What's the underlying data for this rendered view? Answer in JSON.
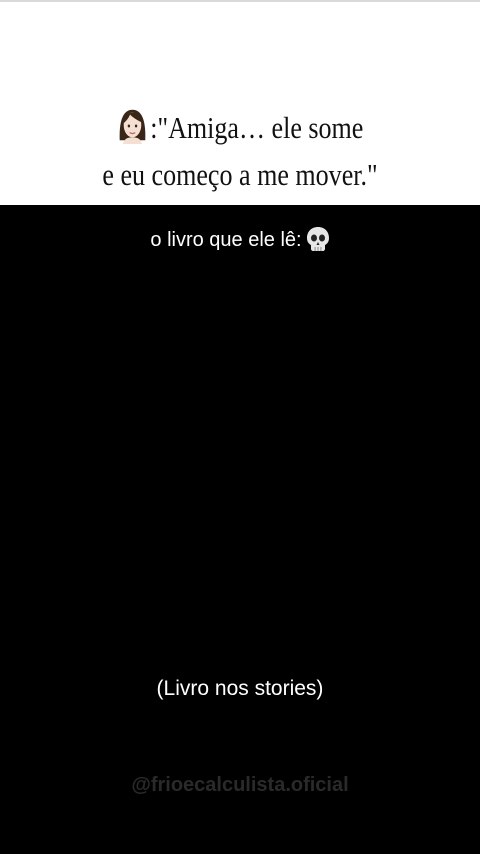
{
  "quote": {
    "line1": ":\"Amiga… ele some",
    "line2": "e eu começo a me mover.\""
  },
  "subtitle": "o livro que ele lê:",
  "caption": "(Livro nos stories)",
  "watermark": "@frioecalculista.oficial",
  "icons": {
    "speaker": "woman-emoji-icon",
    "reaction": "skull-emoji-icon"
  },
  "colors": {
    "top_panel": "#ffffff",
    "background": "#000000",
    "quote_text": "#111111",
    "overlay_text": "#ffffff"
  }
}
